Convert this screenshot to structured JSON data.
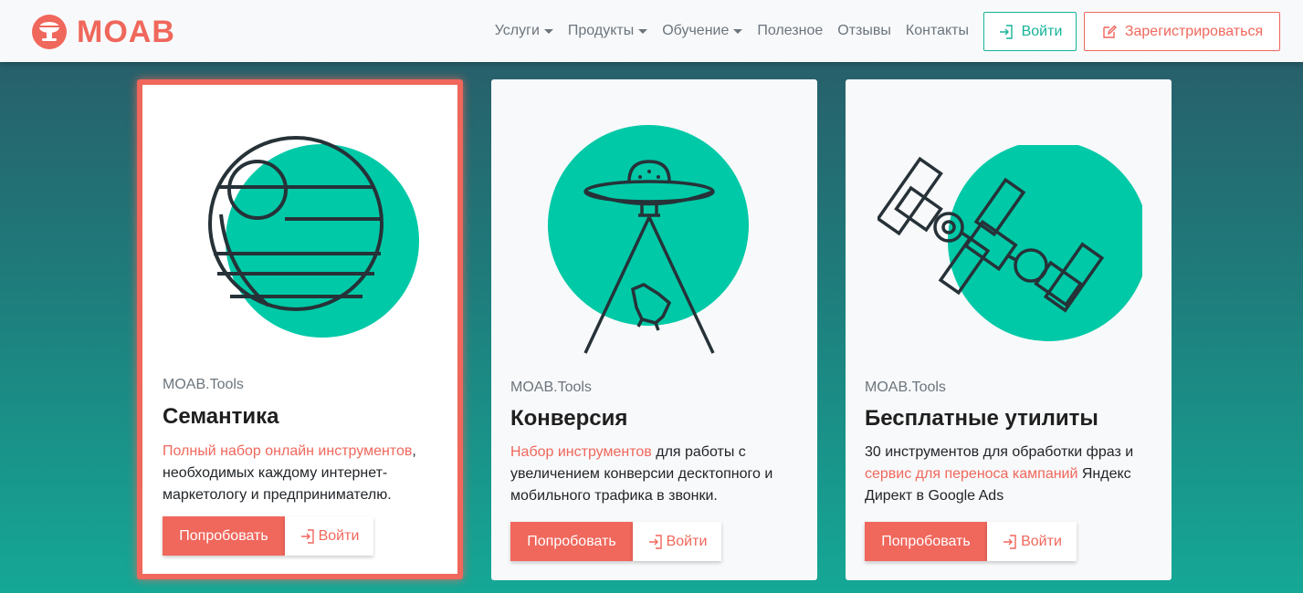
{
  "header": {
    "logo_text": "MOAB",
    "nav": [
      {
        "label": "Услуги",
        "dropdown": true
      },
      {
        "label": "Продукты",
        "dropdown": true
      },
      {
        "label": "Обучение",
        "dropdown": true
      },
      {
        "label": "Полезное",
        "dropdown": false
      },
      {
        "label": "Отзывы",
        "dropdown": false
      },
      {
        "label": "Контакты",
        "dropdown": false
      }
    ],
    "login_label": "Войти",
    "register_label": "Зарегистрироваться"
  },
  "colors": {
    "accent": "#f0675c",
    "teal": "#17b39a",
    "illustration_fill": "#00c9a7"
  },
  "cards": [
    {
      "brand": "MOAB.Tools",
      "title": "Семантика",
      "text_highlight": "Полный набор онлайн инструментов",
      "text_rest_1": ",",
      "text_rest_2": "необходимых каждому интернет-",
      "text_rest_3": "маркетологу и предпринимателю.",
      "try_label": "Попробовать",
      "enter_label": "Войти",
      "icon": "death-star-icon"
    },
    {
      "brand": "MOAB.Tools",
      "title": "Конверсия",
      "text_highlight": "Набор инструментов",
      "text_rest_1": " для работы с",
      "text_rest_2": "увеличением конверсии десктопного и",
      "text_rest_3": "мобильного трафика в звонки.",
      "try_label": "Попробовать",
      "enter_label": "Войти",
      "icon": "ufo-icon"
    },
    {
      "brand": "MOAB.Tools",
      "title": "Бесплатные утилиты",
      "text_line_1": "30 инструментов для обработки фраз и",
      "text_highlight": "сервис для переноса кампаний",
      "text_rest_2": " Яндекс",
      "text_rest_3": "Директ в Google Ads",
      "try_label": "Попробовать",
      "enter_label": "Войти",
      "icon": "satellite-icon"
    }
  ]
}
